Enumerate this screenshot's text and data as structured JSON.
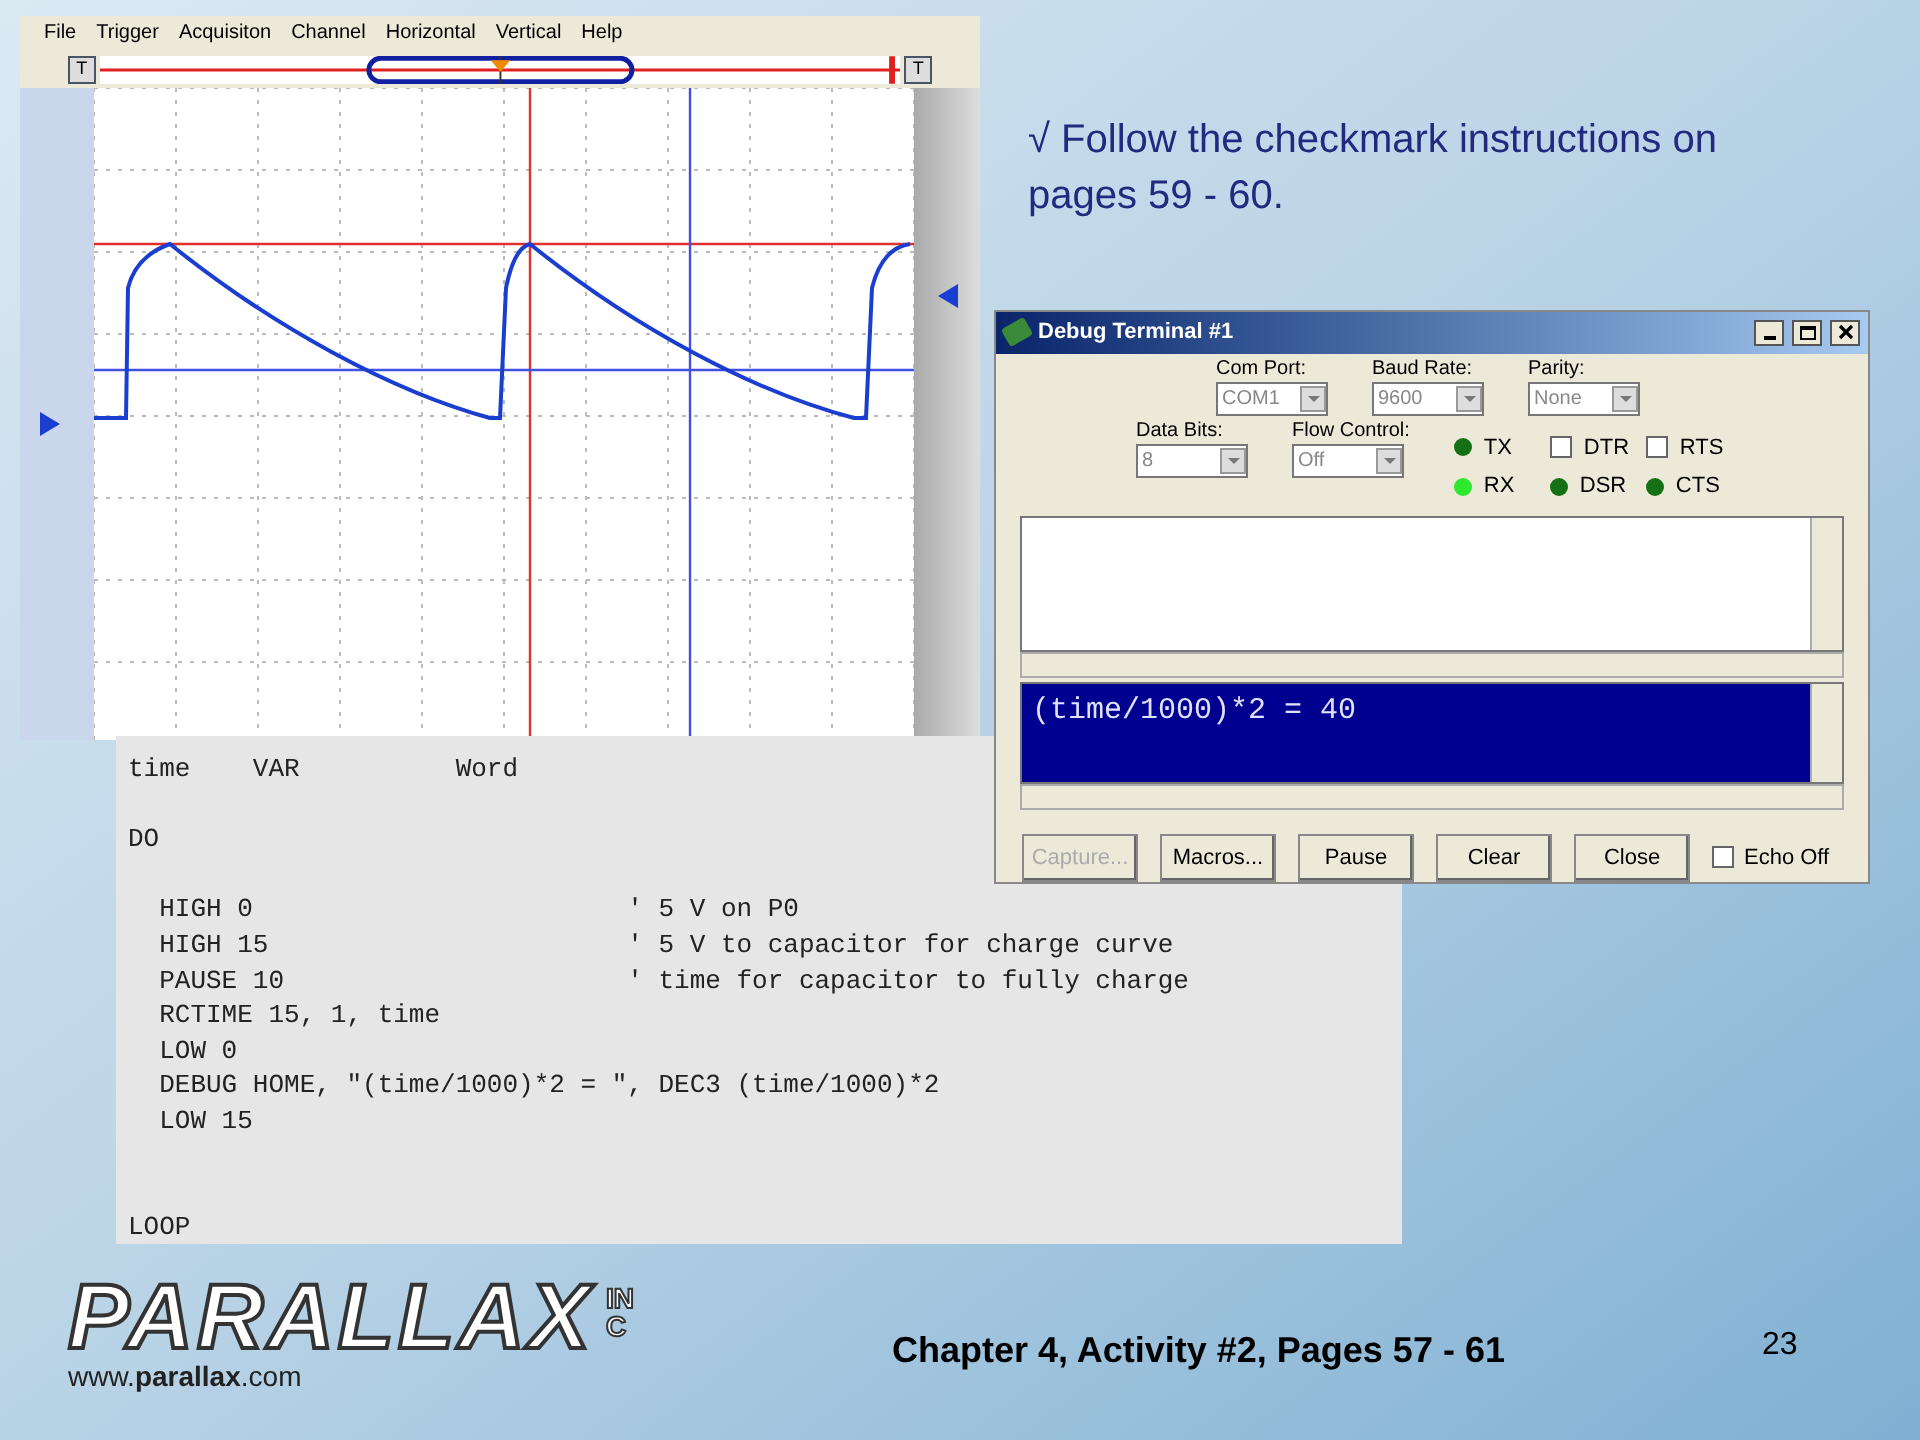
{
  "scope": {
    "menu": [
      "File",
      "Trigger",
      "Acquisiton",
      "Channel",
      "Horizontal",
      "Vertical",
      "Help"
    ],
    "trigger_buttons": [
      "T",
      "T"
    ],
    "trigger_position": {
      "level": 0.5
    }
  },
  "instruction": "√ Follow the checkmark instructions on pages 59 - 60.",
  "code": {
    "blocks": [
      [
        "time    VAR          Word"
      ],
      [
        "DO"
      ],
      [
        "  HIGH 0                        ' 5 V on P0",
        "  HIGH 15                       ' 5 V to capacitor for charge curve",
        "  PAUSE 10                      ' time for capacitor to fully charge",
        "  RCTIME 15, 1, time",
        "  LOW 0",
        "  DEBUG HOME, \"(time/1000)*2 = \", DEC3 (time/1000)*2",
        "  LOW 15"
      ],
      [
        "LOOP"
      ]
    ]
  },
  "terminal": {
    "title": "Debug Terminal #1",
    "dropdowns_row_1": [
      {
        "label": "Com Port:",
        "value": "COM1"
      },
      {
        "label": "Baud Rate:",
        "value": "9600"
      },
      {
        "label": "Parity:",
        "value": "None"
      }
    ],
    "dropdowns_row_2": [
      {
        "label": "Data Bits:",
        "value": "8"
      },
      {
        "label": "Flow Control:",
        "value": "Off"
      }
    ],
    "signals": [
      {
        "kind": "led",
        "label": "TX",
        "on": false
      },
      {
        "kind": "checkbox",
        "label": "DTR",
        "checked": false
      },
      {
        "kind": "checkbox",
        "label": "RTS",
        "checked": false
      },
      {
        "kind": "led",
        "label": "RX",
        "on": true
      },
      {
        "kind": "led",
        "label": "DSR",
        "on": false
      },
      {
        "kind": "led",
        "label": "CTS",
        "on": false
      }
    ],
    "output": "(time/1000)*2 = 40",
    "buttons": [
      {
        "label": "Capture...",
        "disabled": true
      },
      {
        "label": "Macros...",
        "disabled": false
      },
      {
        "label": "Pause",
        "disabled": false
      },
      {
        "label": "Clear",
        "disabled": false
      },
      {
        "label": "Close",
        "disabled": false
      }
    ],
    "echo_off": {
      "label": "Echo Off",
      "checked": false
    }
  },
  "footer": {
    "logo": "PARALLAX",
    "logo_suffix": "INC",
    "website": "www.**parallax**.com",
    "caption": "Chapter 4, Activity #2, Pages 57 - 61",
    "page_number": "23"
  }
}
